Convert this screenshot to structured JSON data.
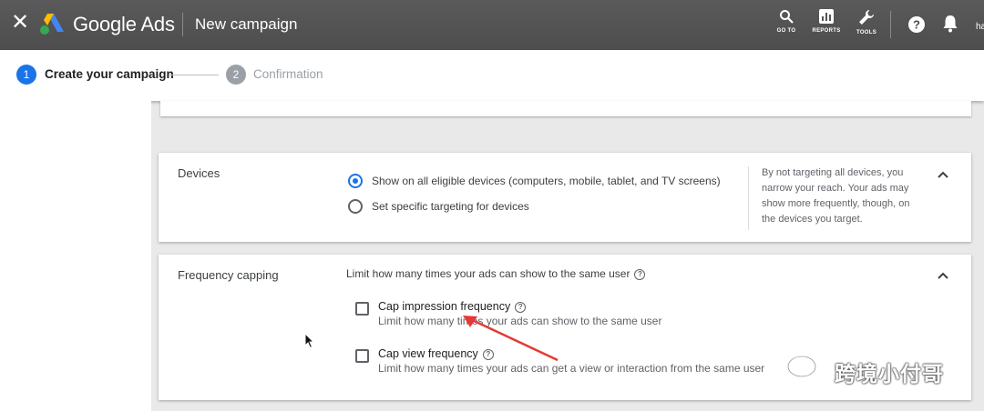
{
  "topbar": {
    "close_icon": "close-icon",
    "brand": "Google Ads",
    "page_title": "New campaign",
    "tools": [
      {
        "label": "GO TO",
        "icon": "search-icon"
      },
      {
        "label": "REPORTS",
        "icon": "reports-icon"
      },
      {
        "label": "TOOLS",
        "icon": "wrench-icon"
      }
    ],
    "help_icon": "help-icon",
    "bell_icon": "bell-icon",
    "user_initial": "ha"
  },
  "stepper": {
    "steps": [
      {
        "number": "1",
        "label": "Create your campaign",
        "active": true
      },
      {
        "number": "2",
        "label": "Confirmation",
        "active": false
      }
    ]
  },
  "devices": {
    "title": "Devices",
    "options": [
      {
        "label": "Show on all eligible devices (computers, mobile, tablet, and TV screens)",
        "selected": true
      },
      {
        "label": "Set specific targeting for devices",
        "selected": false
      }
    ],
    "info": "By not targeting all devices, you narrow your reach. Your ads may show more frequently, though, on the devices you target."
  },
  "frequency": {
    "title": "Frequency capping",
    "description": "Limit how many times your ads can show to the same user",
    "options": [
      {
        "title": "Cap impression frequency",
        "desc": "Limit how many times your ads can show to the same user",
        "checked": false
      },
      {
        "title": "Cap view frequency",
        "desc": "Limit how many times your ads can get a view or interaction from the same user",
        "checked": false
      }
    ]
  },
  "watermark": {
    "text": "跨境小付哥"
  },
  "colors": {
    "accent": "#1a73e8",
    "annotation_arrow": "#e53935"
  }
}
